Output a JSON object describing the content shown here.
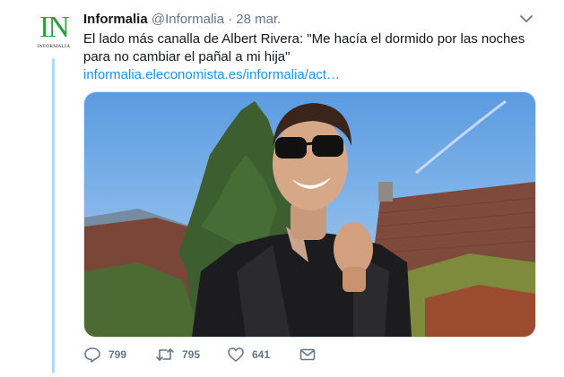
{
  "avatar": {
    "monogram": "IN",
    "wordmark": "INFORMALIA"
  },
  "tweet": {
    "author_name": "Informalia",
    "handle": "@Informalia",
    "separator": "·",
    "date": "28 mar.",
    "text": "El lado más canalla de Albert Rivera: \"Me hacía el dormido por las noches para no cambiar el pañal a mi hija\"",
    "link": "informalia.eleconomista.es/informalia/act…",
    "media_icon": "photo"
  },
  "actions": {
    "reply_count": "799",
    "retweet_count": "795",
    "like_count": "641"
  },
  "colors": {
    "accent": "#1b95e0",
    "muted": "#657786",
    "thread_line": "#b1d9f5",
    "brand_green": "#2e9e3e"
  }
}
